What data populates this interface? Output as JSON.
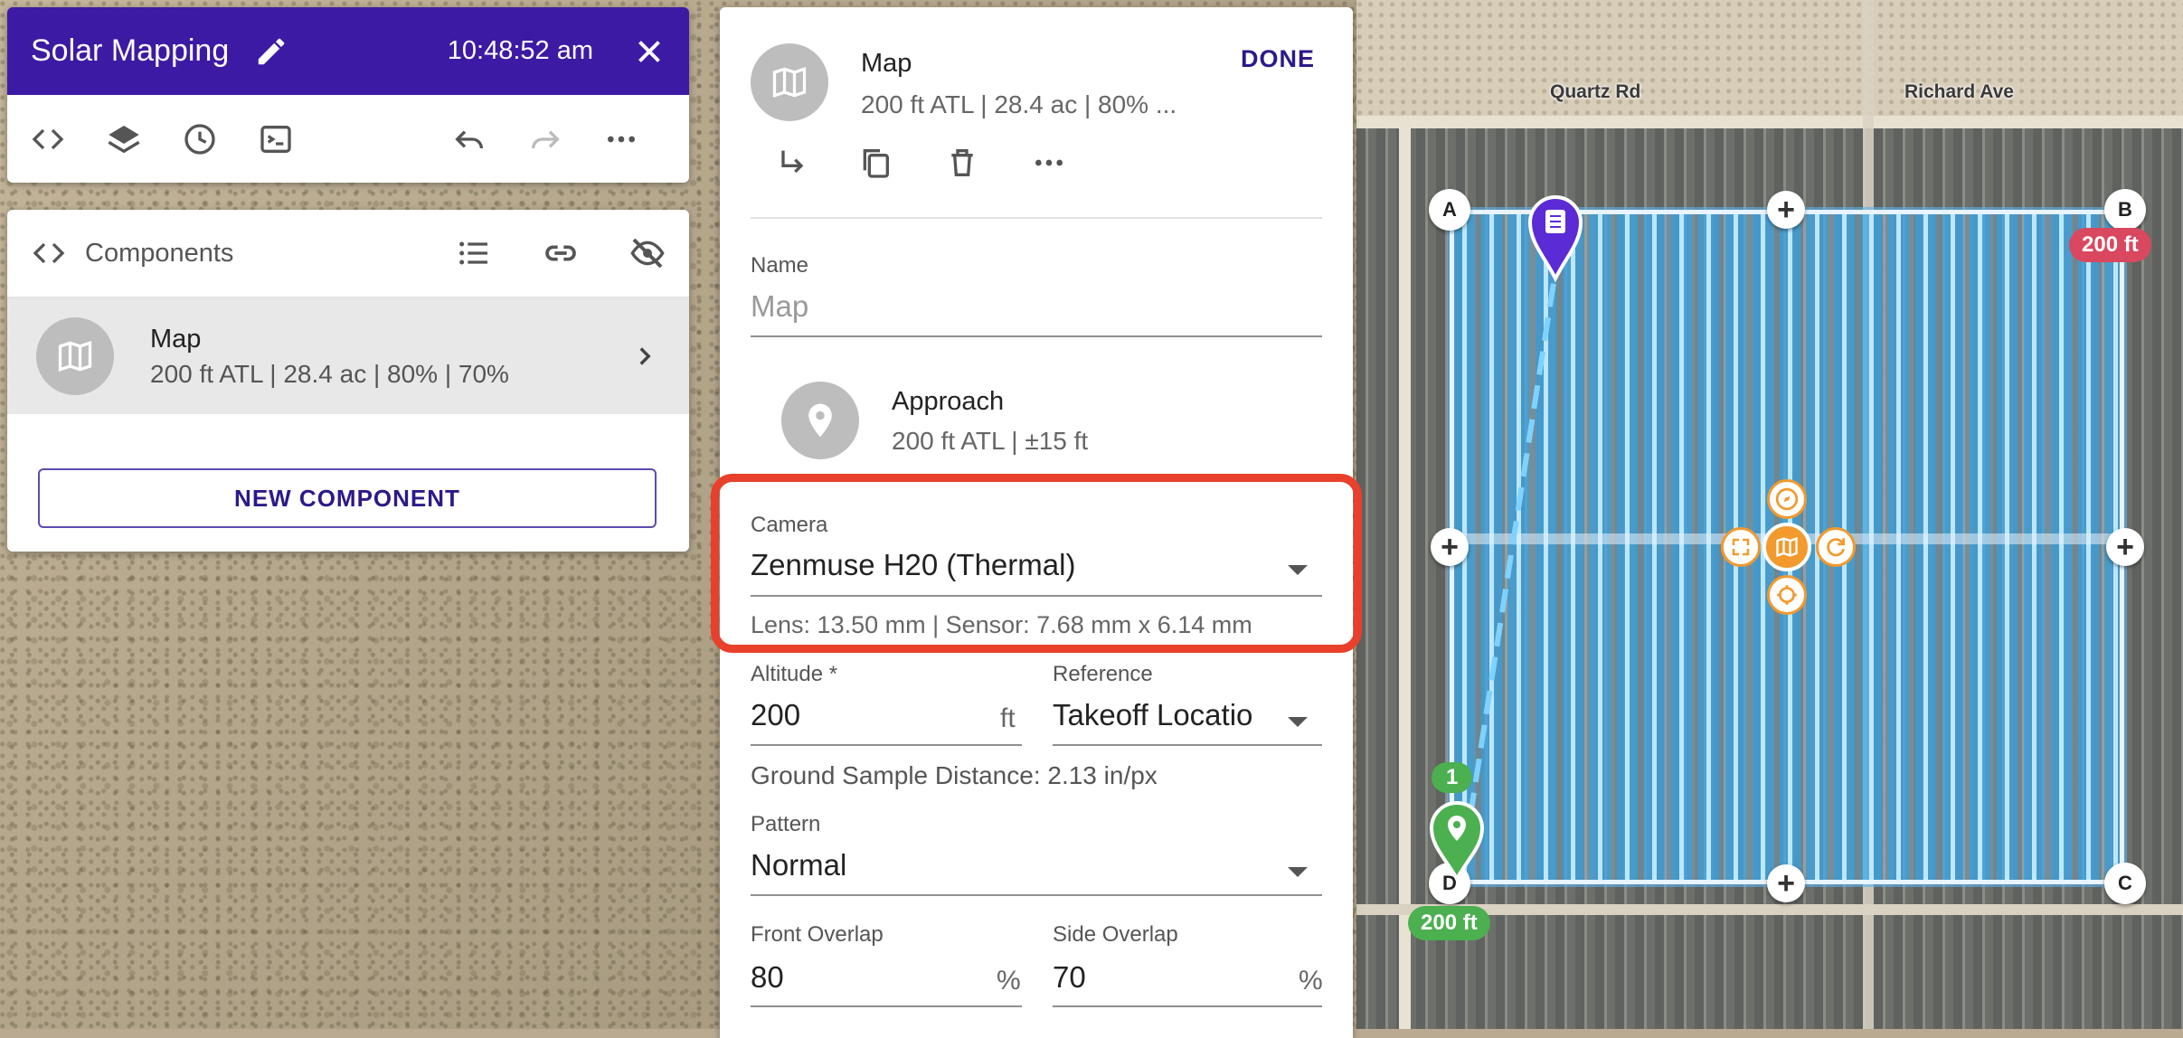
{
  "header": {
    "title": "Solar Mapping",
    "time": "10:48:52 am",
    "close_icon": "close-icon",
    "edit_icon": "pencil-icon"
  },
  "toolbar": {
    "icons": [
      "code-icon",
      "layers-icon",
      "history-icon",
      "terminal-icon",
      "undo-icon",
      "redo-icon",
      "more-icon"
    ]
  },
  "components_panel": {
    "title": "Components",
    "items": [
      {
        "name": "Map",
        "summary": "200 ft ATL | 28.4 ac | 80% | 70%"
      }
    ],
    "new_button": "NEW COMPONENT"
  },
  "editor": {
    "title": "Map",
    "subtitle": "200 ft ATL | 28.4 ac | 80% ...",
    "done_label": "DONE",
    "name_label": "Name",
    "name_placeholder": "Map",
    "approach": {
      "title": "Approach",
      "summary": "200 ft ATL | ±15 ft"
    },
    "camera": {
      "label": "Camera",
      "value": "Zenmuse H20 (Thermal)",
      "details": "Lens: 13.50 mm | Sensor: 7.68 mm x 6.14 mm"
    },
    "altitude": {
      "label": "Altitude *",
      "value": "200",
      "unit": "ft"
    },
    "reference": {
      "label": "Reference",
      "value": "Takeoff Locatio"
    },
    "gsd": "Ground Sample Distance: 2.13 in/px",
    "pattern": {
      "label": "Pattern",
      "value": "Normal"
    },
    "front_overlap": {
      "label": "Front Overlap",
      "value": "80",
      "unit": "%"
    },
    "side_overlap": {
      "label": "Side Overlap",
      "value": "70",
      "unit": "%"
    }
  },
  "map": {
    "streets": [
      "Quartz Rd",
      "Richard Ave"
    ],
    "corners": [
      "A",
      "B",
      "C",
      "D"
    ],
    "start_label": "1",
    "altitude_badges": [
      "200 ft",
      "200 ft"
    ]
  },
  "colors": {
    "header_bg": "#3d1aa3",
    "accent": "#2b1a8a",
    "highlight": "#e8402b",
    "flight_blue": "#3caaeb",
    "start_green": "#4caf50",
    "alt_red": "#d9485f",
    "control_orange": "#f29a2e"
  }
}
